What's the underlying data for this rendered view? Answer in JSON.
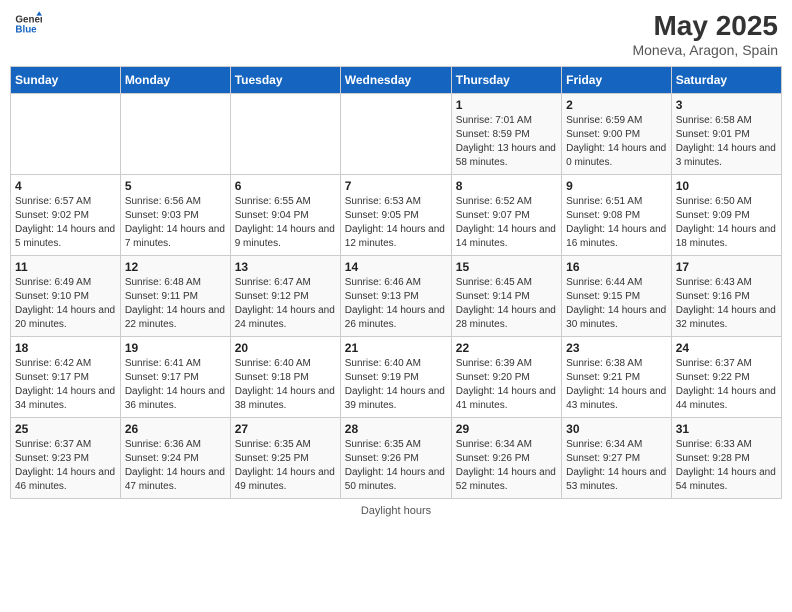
{
  "header": {
    "logo_general": "General",
    "logo_blue": "Blue",
    "month": "May 2025",
    "location": "Moneva, Aragon, Spain"
  },
  "days_of_week": [
    "Sunday",
    "Monday",
    "Tuesday",
    "Wednesday",
    "Thursday",
    "Friday",
    "Saturday"
  ],
  "weeks": [
    [
      {
        "day": "",
        "info": ""
      },
      {
        "day": "",
        "info": ""
      },
      {
        "day": "",
        "info": ""
      },
      {
        "day": "",
        "info": ""
      },
      {
        "day": "1",
        "info": "Sunrise: 7:01 AM\nSunset: 8:59 PM\nDaylight: 13 hours and 58 minutes."
      },
      {
        "day": "2",
        "info": "Sunrise: 6:59 AM\nSunset: 9:00 PM\nDaylight: 14 hours and 0 minutes."
      },
      {
        "day": "3",
        "info": "Sunrise: 6:58 AM\nSunset: 9:01 PM\nDaylight: 14 hours and 3 minutes."
      }
    ],
    [
      {
        "day": "4",
        "info": "Sunrise: 6:57 AM\nSunset: 9:02 PM\nDaylight: 14 hours and 5 minutes."
      },
      {
        "day": "5",
        "info": "Sunrise: 6:56 AM\nSunset: 9:03 PM\nDaylight: 14 hours and 7 minutes."
      },
      {
        "day": "6",
        "info": "Sunrise: 6:55 AM\nSunset: 9:04 PM\nDaylight: 14 hours and 9 minutes."
      },
      {
        "day": "7",
        "info": "Sunrise: 6:53 AM\nSunset: 9:05 PM\nDaylight: 14 hours and 12 minutes."
      },
      {
        "day": "8",
        "info": "Sunrise: 6:52 AM\nSunset: 9:07 PM\nDaylight: 14 hours and 14 minutes."
      },
      {
        "day": "9",
        "info": "Sunrise: 6:51 AM\nSunset: 9:08 PM\nDaylight: 14 hours and 16 minutes."
      },
      {
        "day": "10",
        "info": "Sunrise: 6:50 AM\nSunset: 9:09 PM\nDaylight: 14 hours and 18 minutes."
      }
    ],
    [
      {
        "day": "11",
        "info": "Sunrise: 6:49 AM\nSunset: 9:10 PM\nDaylight: 14 hours and 20 minutes."
      },
      {
        "day": "12",
        "info": "Sunrise: 6:48 AM\nSunset: 9:11 PM\nDaylight: 14 hours and 22 minutes."
      },
      {
        "day": "13",
        "info": "Sunrise: 6:47 AM\nSunset: 9:12 PM\nDaylight: 14 hours and 24 minutes."
      },
      {
        "day": "14",
        "info": "Sunrise: 6:46 AM\nSunset: 9:13 PM\nDaylight: 14 hours and 26 minutes."
      },
      {
        "day": "15",
        "info": "Sunrise: 6:45 AM\nSunset: 9:14 PM\nDaylight: 14 hours and 28 minutes."
      },
      {
        "day": "16",
        "info": "Sunrise: 6:44 AM\nSunset: 9:15 PM\nDaylight: 14 hours and 30 minutes."
      },
      {
        "day": "17",
        "info": "Sunrise: 6:43 AM\nSunset: 9:16 PM\nDaylight: 14 hours and 32 minutes."
      }
    ],
    [
      {
        "day": "18",
        "info": "Sunrise: 6:42 AM\nSunset: 9:17 PM\nDaylight: 14 hours and 34 minutes."
      },
      {
        "day": "19",
        "info": "Sunrise: 6:41 AM\nSunset: 9:17 PM\nDaylight: 14 hours and 36 minutes."
      },
      {
        "day": "20",
        "info": "Sunrise: 6:40 AM\nSunset: 9:18 PM\nDaylight: 14 hours and 38 minutes."
      },
      {
        "day": "21",
        "info": "Sunrise: 6:40 AM\nSunset: 9:19 PM\nDaylight: 14 hours and 39 minutes."
      },
      {
        "day": "22",
        "info": "Sunrise: 6:39 AM\nSunset: 9:20 PM\nDaylight: 14 hours and 41 minutes."
      },
      {
        "day": "23",
        "info": "Sunrise: 6:38 AM\nSunset: 9:21 PM\nDaylight: 14 hours and 43 minutes."
      },
      {
        "day": "24",
        "info": "Sunrise: 6:37 AM\nSunset: 9:22 PM\nDaylight: 14 hours and 44 minutes."
      }
    ],
    [
      {
        "day": "25",
        "info": "Sunrise: 6:37 AM\nSunset: 9:23 PM\nDaylight: 14 hours and 46 minutes."
      },
      {
        "day": "26",
        "info": "Sunrise: 6:36 AM\nSunset: 9:24 PM\nDaylight: 14 hours and 47 minutes."
      },
      {
        "day": "27",
        "info": "Sunrise: 6:35 AM\nSunset: 9:25 PM\nDaylight: 14 hours and 49 minutes."
      },
      {
        "day": "28",
        "info": "Sunrise: 6:35 AM\nSunset: 9:26 PM\nDaylight: 14 hours and 50 minutes."
      },
      {
        "day": "29",
        "info": "Sunrise: 6:34 AM\nSunset: 9:26 PM\nDaylight: 14 hours and 52 minutes."
      },
      {
        "day": "30",
        "info": "Sunrise: 6:34 AM\nSunset: 9:27 PM\nDaylight: 14 hours and 53 minutes."
      },
      {
        "day": "31",
        "info": "Sunrise: 6:33 AM\nSunset: 9:28 PM\nDaylight: 14 hours and 54 minutes."
      }
    ]
  ],
  "footer": "Daylight hours"
}
